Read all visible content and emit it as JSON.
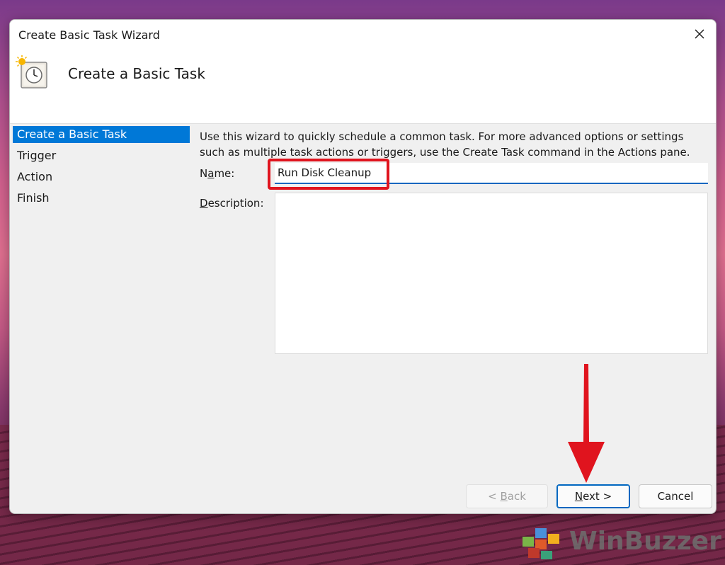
{
  "window": {
    "title": "Create Basic Task Wizard",
    "header_title": "Create a Basic Task"
  },
  "sidebar": {
    "items": [
      {
        "label": "Create a Basic Task",
        "active": true
      },
      {
        "label": "Trigger",
        "active": false
      },
      {
        "label": "Action",
        "active": false
      },
      {
        "label": "Finish",
        "active": false
      }
    ]
  },
  "form": {
    "intro": "Use this wizard to quickly schedule a common task.  For more advanced options or settings such as multiple task actions or triggers, use the Create Task command in the Actions pane.",
    "name_label_access": "a",
    "name_label_before": "N",
    "name_label_after": "me:",
    "name_value": "Run Disk Cleanup",
    "description_label_access": "D",
    "description_label_rest": "escription:",
    "description_value": ""
  },
  "buttons": {
    "back_prefix": "< ",
    "back_access": "B",
    "back_rest": "ack",
    "next_access": "N",
    "next_rest": "ext >",
    "cancel": "Cancel"
  },
  "watermark": {
    "text": "WinBuzzer"
  },
  "colors": {
    "accent": "#0078d7",
    "highlight": "#e0141e"
  }
}
